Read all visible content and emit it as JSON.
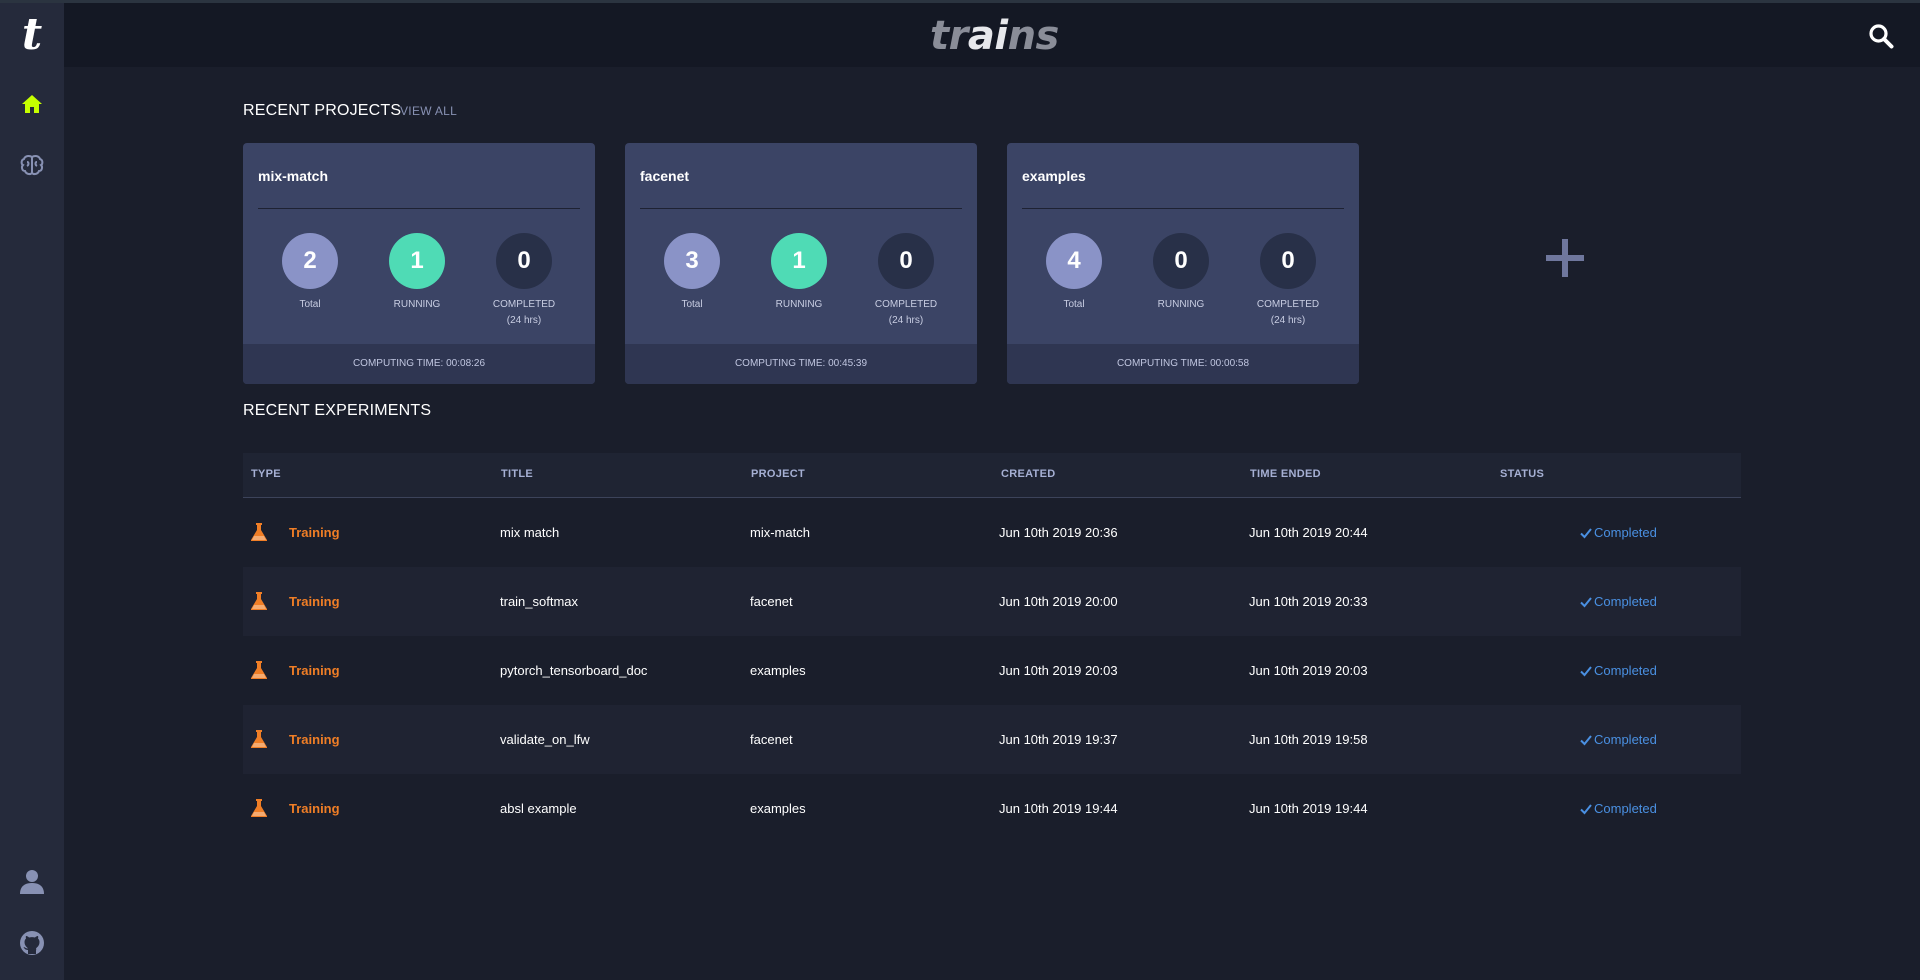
{
  "app": {
    "logo_letter": "t",
    "brand_prefix": "tr",
    "brand_mid": "ai",
    "brand_suffix": "ns",
    "accent_color": "#c6ff00"
  },
  "sidebar": {
    "items": [
      {
        "name": "home",
        "icon": "home-icon",
        "active": true
      },
      {
        "name": "models",
        "icon": "brain-icon",
        "active": false
      }
    ],
    "bottom_items": [
      {
        "name": "profile",
        "icon": "user-icon"
      },
      {
        "name": "github",
        "icon": "github-icon"
      }
    ]
  },
  "header": {
    "search_icon": "search-icon"
  },
  "recent_projects": {
    "title": "RECENT PROJECTS",
    "view_all": "VIEW ALL",
    "add_icon": "plus-icon",
    "cards": [
      {
        "name": "mix-match",
        "total": "2",
        "total_label": "Total",
        "running": "1",
        "running_label": "RUNNING",
        "completed": "0",
        "completed_label": "COMPLETED",
        "completed_sub": "(24 hrs)",
        "computing_time": "COMPUTING TIME: 00:08:26"
      },
      {
        "name": "facenet",
        "total": "3",
        "total_label": "Total",
        "running": "1",
        "running_label": "RUNNING",
        "completed": "0",
        "completed_label": "COMPLETED",
        "completed_sub": "(24 hrs)",
        "computing_time": "COMPUTING TIME: 00:45:39"
      },
      {
        "name": "examples",
        "total": "4",
        "total_label": "Total",
        "running": "0",
        "running_label": "RUNNING",
        "completed": "0",
        "completed_label": "COMPLETED",
        "completed_sub": "(24 hrs)",
        "computing_time": "COMPUTING TIME: 00:00:58"
      }
    ]
  },
  "recent_experiments": {
    "title": "RECENT EXPERIMENTS",
    "columns": [
      "TYPE",
      "TITLE",
      "PROJECT",
      "CREATED",
      "TIME ENDED",
      "STATUS"
    ],
    "rows": [
      {
        "type": "Training",
        "title": "mix match",
        "project": "mix-match",
        "created": "Jun 10th 2019 20:36",
        "ended": "Jun 10th 2019 20:44",
        "status": "Completed"
      },
      {
        "type": "Training",
        "title": "train_softmax",
        "project": "facenet",
        "created": "Jun 10th 2019 20:00",
        "ended": "Jun 10th 2019 20:33",
        "status": "Completed"
      },
      {
        "type": "Training",
        "title": "pytorch_tensorboard_doc",
        "project": "examples",
        "created": "Jun 10th 2019 20:03",
        "ended": "Jun 10th 2019 20:03",
        "status": "Completed"
      },
      {
        "type": "Training",
        "title": "validate_on_lfw",
        "project": "facenet",
        "created": "Jun 10th 2019 19:37",
        "ended": "Jun 10th 2019 19:58",
        "status": "Completed"
      },
      {
        "type": "Training",
        "title": "absl example",
        "project": "examples",
        "created": "Jun 10th 2019 19:44",
        "ended": "Jun 10th 2019 19:44",
        "status": "Completed"
      }
    ]
  }
}
